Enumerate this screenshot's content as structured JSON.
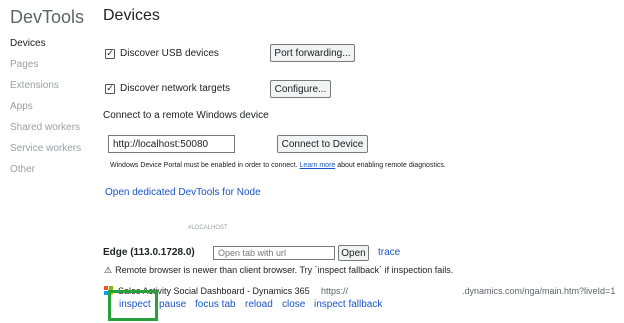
{
  "app": {
    "title": "DevTools"
  },
  "sidebar": {
    "items": [
      {
        "label": "Devices",
        "active": true
      },
      {
        "label": "Pages",
        "active": false
      },
      {
        "label": "Extensions",
        "active": false
      },
      {
        "label": "Apps",
        "active": false
      },
      {
        "label": "Shared workers",
        "active": false
      },
      {
        "label": "Service workers",
        "active": false
      },
      {
        "label": "Other",
        "active": false
      }
    ]
  },
  "main": {
    "title": "Devices",
    "usb": {
      "checked_glyph": "✓",
      "label": "Discover USB devices",
      "button": "Port forwarding..."
    },
    "network": {
      "checked_glyph": "✓",
      "label": "Discover network targets",
      "button": "Configure..."
    },
    "remote": {
      "heading": "Connect to a remote Windows device",
      "input_value": "http://localhost:50080",
      "connect_button": "Connect to Device",
      "note_prefix": "Windows Device Portal must be enabled in order to connect.",
      "note_link": "Learn more",
      "note_suffix": "about enabling remote diagnostics."
    },
    "open_devtools_node": "Open dedicated DevTools for Node",
    "host_label": "#LOCALHOST",
    "browser": {
      "name": "Edge (113.0.1728.0)",
      "tab_placeholder": "Open tab with url",
      "open_button": "Open",
      "trace_link": "trace",
      "warning": "Remote browser is newer than client browser. Try `inspect fallback` if inspection fails.",
      "warning_icon": "warning-icon"
    },
    "target": {
      "title": "Sales Activity Social Dashboard - Dynamics 365",
      "url_prefix": "https://",
      "url_suffix": ".dynamics.com/nga/main.htm?liveId=1",
      "actions": {
        "inspect": "inspect",
        "pause": "pause",
        "focus_tab": "focus tab",
        "reload": "reload",
        "close": "close",
        "inspect_fallback": "inspect fallback"
      }
    },
    "colors": {
      "link": "#1a55c7",
      "highlight": "#2aa03a",
      "ms_red": "#f25022",
      "ms_green": "#7fba00",
      "ms_blue": "#00a4ef",
      "ms_yellow": "#ffb900"
    }
  }
}
